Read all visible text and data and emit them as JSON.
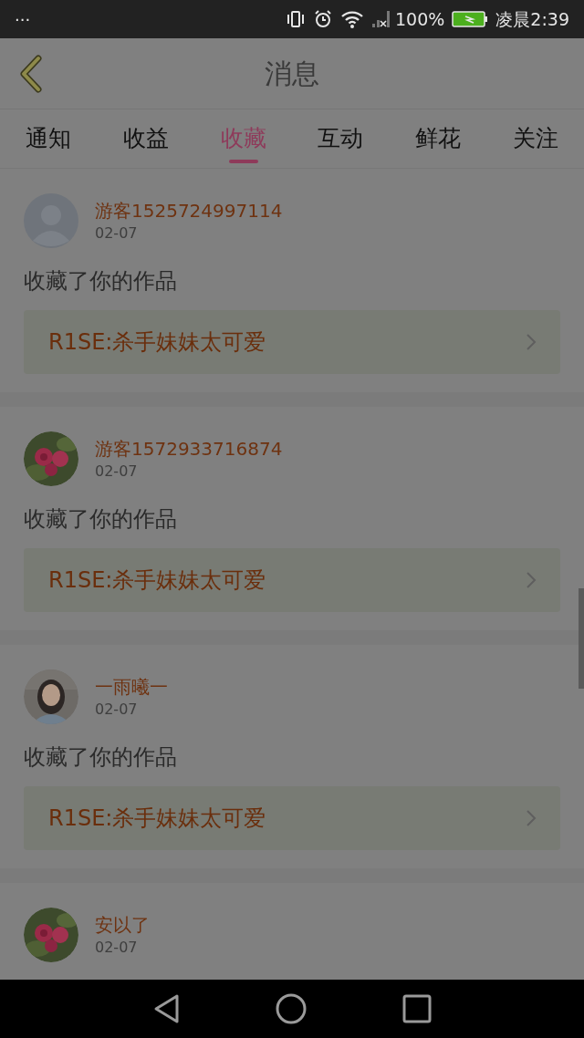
{
  "status_bar": {
    "menu": "···",
    "battery": "100%",
    "time": "凌晨2:39"
  },
  "header": {
    "title": "消息"
  },
  "tabs": [
    {
      "label": "通知",
      "selected": false
    },
    {
      "label": "收益",
      "selected": false
    },
    {
      "label": "收藏",
      "selected": true
    },
    {
      "label": "互动",
      "selected": false
    },
    {
      "label": "鲜花",
      "selected": false
    },
    {
      "label": "关注",
      "selected": false
    }
  ],
  "messages": [
    {
      "kind": "silhouette",
      "name": "游客1525724997114",
      "date": "02-07",
      "text": "收藏了你的作品",
      "work": "R1SE:杀手妹妹太可爱"
    },
    {
      "kind": "picture",
      "name": "游客1572933716874",
      "date": "02-07",
      "text": "收藏了你的作品",
      "work": "R1SE:杀手妹妹太可爱"
    },
    {
      "kind": "picture",
      "name": "一雨曦一",
      "date": "02-07",
      "text": "收藏了你的作品",
      "work": "R1SE:杀手妹妹太可爱"
    },
    {
      "kind": "picture",
      "name": "安以了",
      "date": "02-07"
    }
  ]
}
